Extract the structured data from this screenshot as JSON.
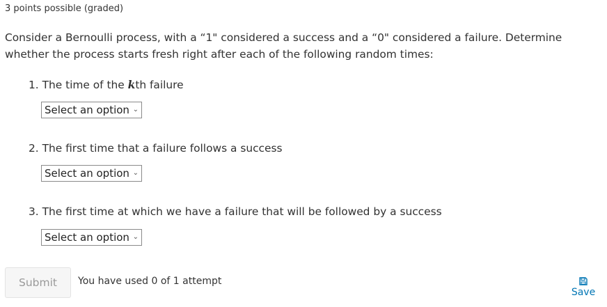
{
  "header": {
    "points": "3 points possible (graded)"
  },
  "problem": {
    "prompt": "Consider a Bernoulli process, with a “1\" considered a success and a “0\" considered a failure. Determine whether the process starts fresh right after each of the following random times:",
    "questions": [
      {
        "prefix": "1. The time of the ",
        "math": "k",
        "suffix": "th failure",
        "select_value": "Select an option"
      },
      {
        "text": "2. The first time that a failure follows a success",
        "select_value": "Select an option"
      },
      {
        "text": "3. The first time at which we have a failure that will be followed by a success",
        "select_value": "Select an option"
      }
    ]
  },
  "actions": {
    "submit_label": "Submit",
    "attempts_text": "You have used 0 of 1 attempt",
    "save_label": "Save",
    "save_icon": "floppy-disk-icon",
    "link_color": "#0075b4",
    "chevron_icon": "chevron-down-icon"
  }
}
